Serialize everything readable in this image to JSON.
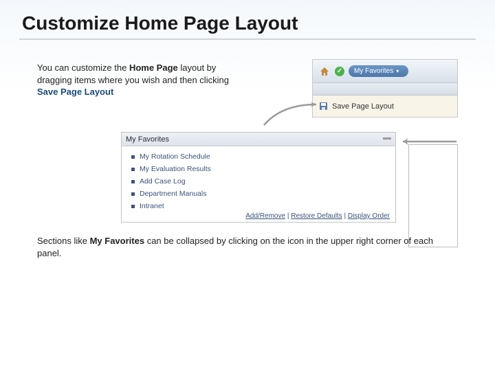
{
  "title": "Customize Home Page Layout",
  "intro": {
    "pre": "You can customize the ",
    "home_page": "Home Page",
    "mid": " layout by dragging items where you wish and then clicking ",
    "save_page_layout": "Save Page Layout"
  },
  "toolbar": {
    "favorites_pill": "My Favorites",
    "save_label": "Save Page Layout"
  },
  "panel": {
    "header": "My Favorites",
    "items": [
      "My Rotation Schedule",
      "My Evaluation Results",
      "Add Case Log",
      "Department Manuals",
      "Intranet"
    ],
    "footer_links": [
      "Add/Remove",
      "Restore Defaults",
      "Display Order"
    ]
  },
  "bottom": {
    "pre": "Sections like ",
    "my_favorites": "My Favorites",
    "post": " can be collapsed by clicking on the icon in the upper right corner of each panel."
  }
}
